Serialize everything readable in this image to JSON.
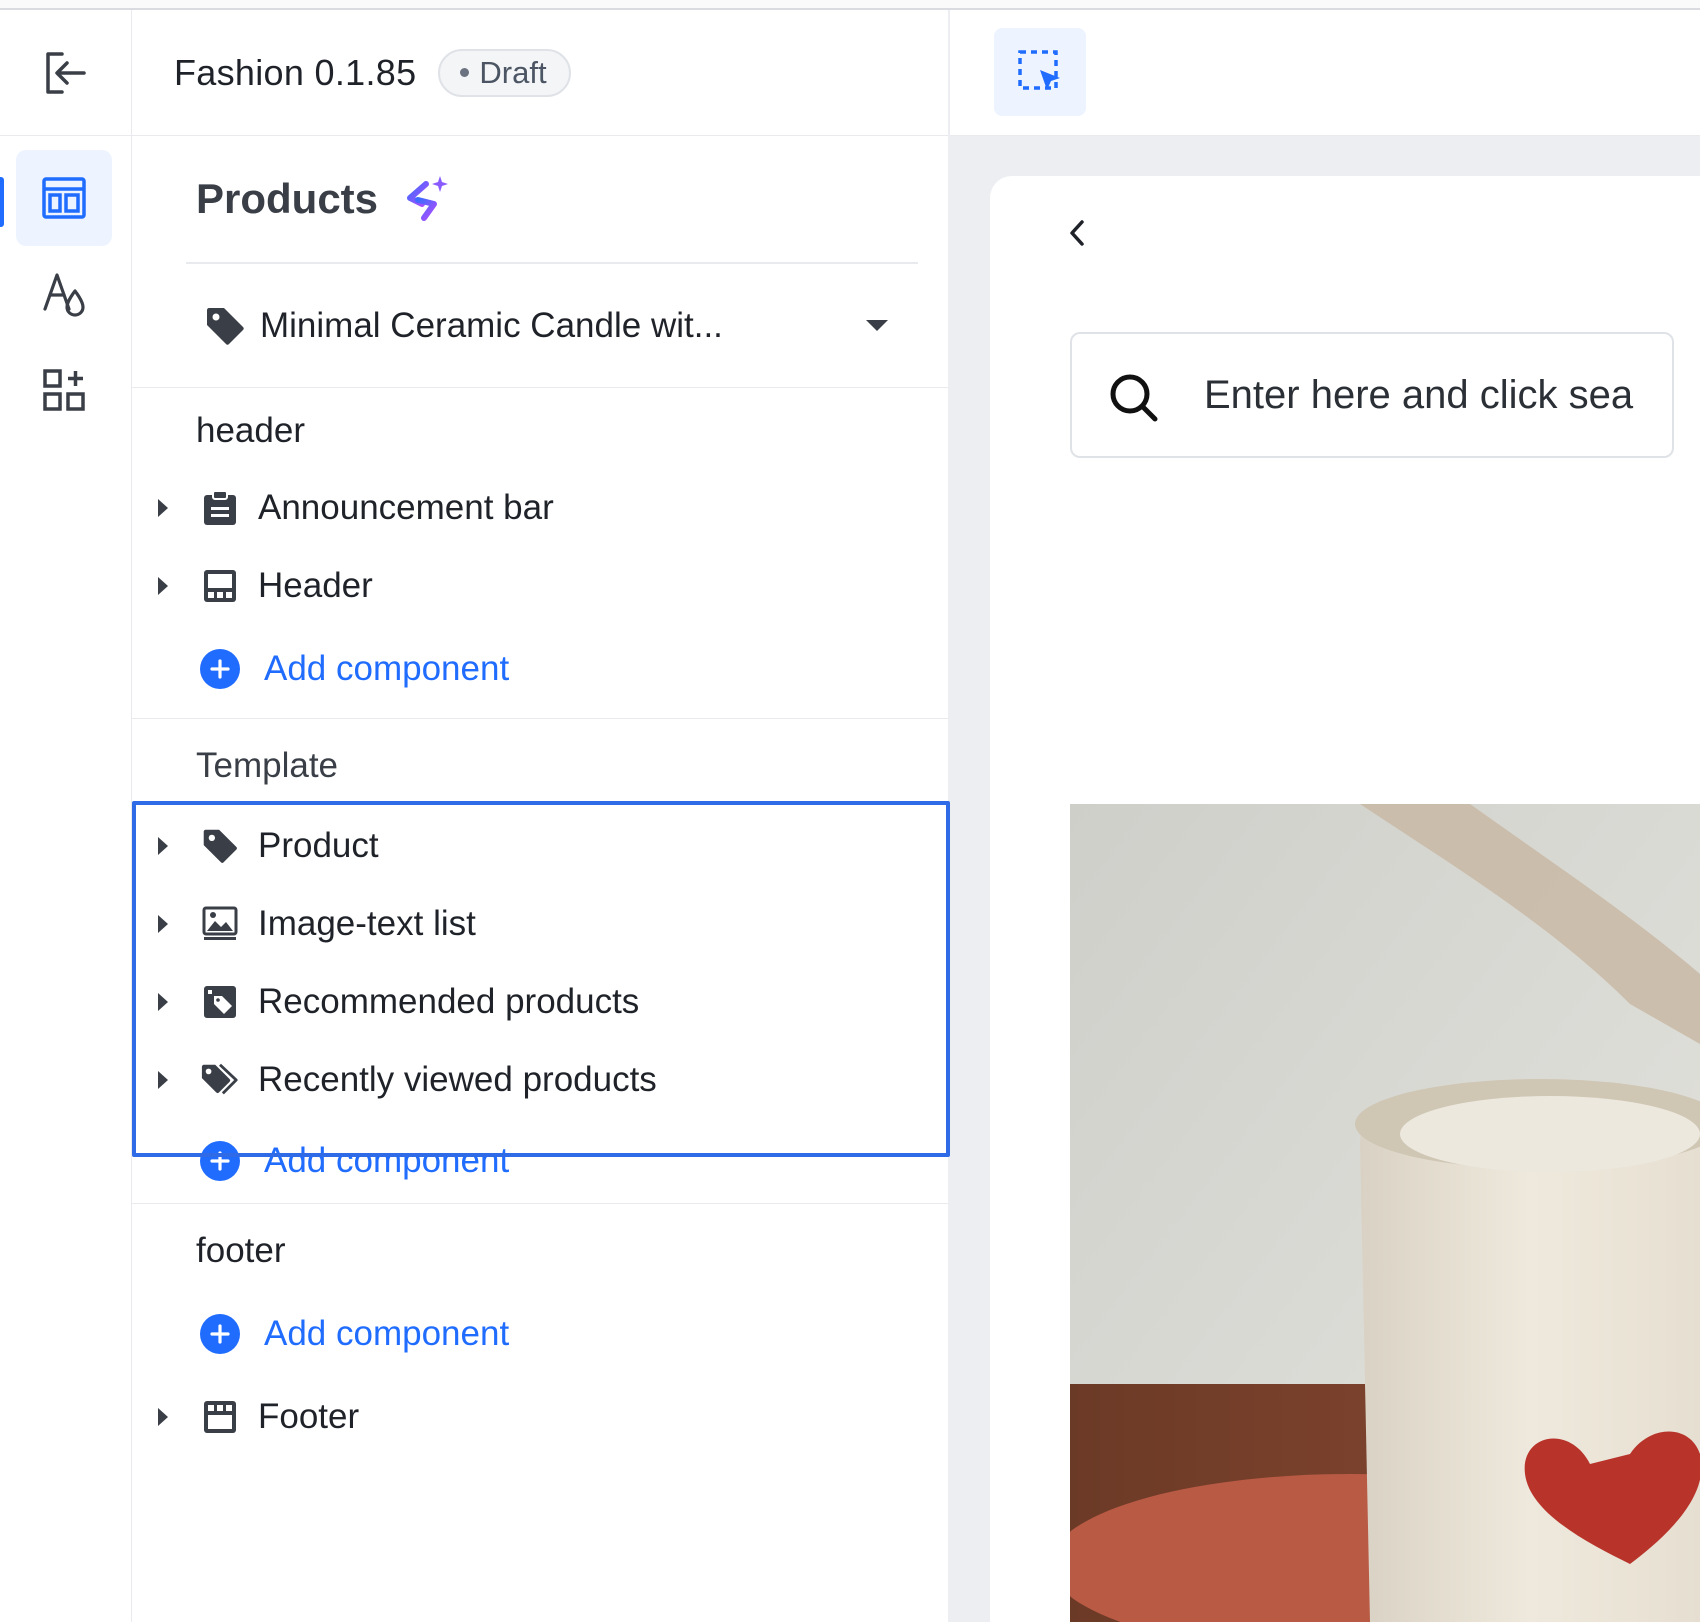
{
  "toolbar": {
    "app_name": "Fashion",
    "version": "0.1.85",
    "status": "Draft"
  },
  "rail": {
    "items": [
      {
        "icon": "layout-icon",
        "active": true
      },
      {
        "icon": "typography-icon",
        "active": false
      },
      {
        "icon": "add-widget-icon",
        "active": false
      }
    ]
  },
  "panel": {
    "page_title": "Products",
    "selected_product": "Minimal Ceramic Candle wit...",
    "sections": {
      "header": {
        "title": "header",
        "items": [
          {
            "label": "Announcement bar",
            "icon": "clipboard-icon"
          },
          {
            "label": "Header",
            "icon": "header-layout-icon"
          }
        ],
        "add_label": "Add component"
      },
      "template": {
        "title": "Template",
        "items": [
          {
            "label": "Product",
            "icon": "tag-icon"
          },
          {
            "label": "Image-text list",
            "icon": "image-icon"
          },
          {
            "label": "Recommended products",
            "icon": "recommended-tag-icon"
          },
          {
            "label": "Recently viewed products",
            "icon": "tags-icon"
          }
        ],
        "add_label": "Add component"
      },
      "footer": {
        "title": "footer",
        "add_label": "Add component",
        "items": [
          {
            "label": "Footer",
            "icon": "footer-layout-icon"
          }
        ]
      }
    }
  },
  "preview": {
    "search_placeholder": "Enter here and click sea"
  },
  "colors": {
    "accent": "#1f6cff",
    "highlight_border": "#2f6be6",
    "active_bg": "#eef4ff"
  }
}
